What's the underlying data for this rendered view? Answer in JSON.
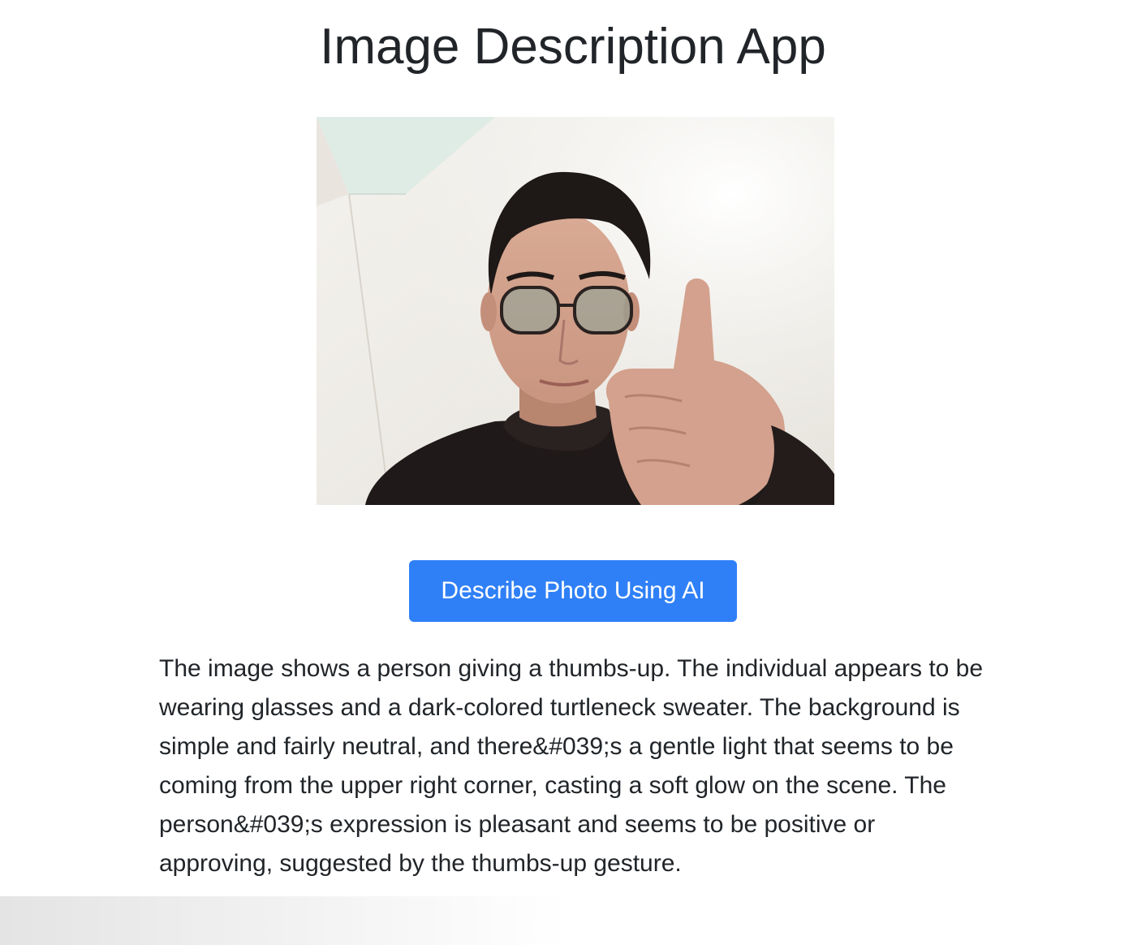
{
  "header": {
    "title": "Image Description App"
  },
  "photo": {
    "subject": "person-giving-thumbs-up"
  },
  "actions": {
    "describe_label": "Describe Photo Using AI"
  },
  "result": {
    "description": "The image shows a person giving a thumbs-up. The individual appears to be wearing glasses and a dark-colored turtleneck sweater. The background is simple and fairly neutral, and there&#039;s a gentle light that seems to be coming from the upper right corner, casting a soft glow on the scene. The person&#039;s expression is pleasant and seems to be positive or approving, suggested by the thumbs-up gesture."
  },
  "colors": {
    "button_bg": "#2f80f7",
    "button_text": "#ffffff",
    "text": "#212529",
    "background": "#ffffff"
  }
}
